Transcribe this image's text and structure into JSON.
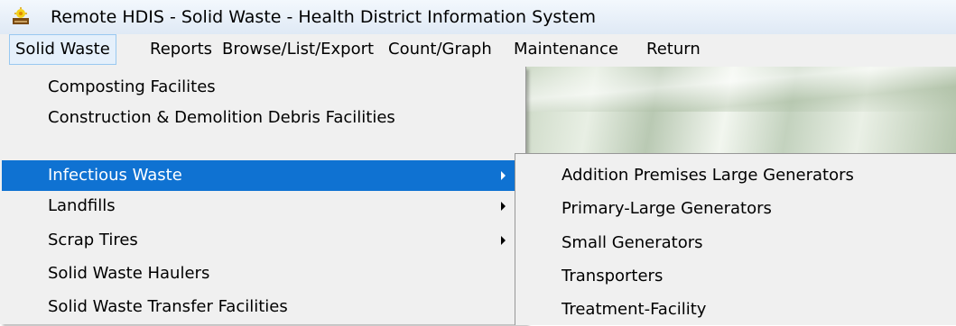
{
  "window": {
    "title": "Remote HDIS - Solid Waste - Health District Information System"
  },
  "menubar": {
    "items": [
      {
        "label": "Solid Waste"
      },
      {
        "label": "Reports"
      },
      {
        "label": "Browse/List/Export"
      },
      {
        "label": "Count/Graph"
      },
      {
        "label": "Maintenance"
      },
      {
        "label": "Return"
      }
    ]
  },
  "dropdown": {
    "items": [
      {
        "label": "Composting Facilites"
      },
      {
        "label": "Construction & Demolition Debris Facilities"
      },
      {
        "label": "Infectious Waste"
      },
      {
        "label": "Landfills"
      },
      {
        "label": "Scrap Tires"
      },
      {
        "label": "Solid Waste Haulers"
      },
      {
        "label": "Solid Waste Transfer Facilities"
      }
    ]
  },
  "submenu": {
    "items": [
      {
        "label": "Addition Premises Large Generators"
      },
      {
        "label": "Primary-Large Generators"
      },
      {
        "label": "Small Generators"
      },
      {
        "label": "Transporters"
      },
      {
        "label": "Treatment-Facility"
      }
    ]
  },
  "colors": {
    "highlight": "#0f72d2",
    "menu_bg": "#f0f0f0",
    "active_menu_bg": "#e5f0fb"
  }
}
